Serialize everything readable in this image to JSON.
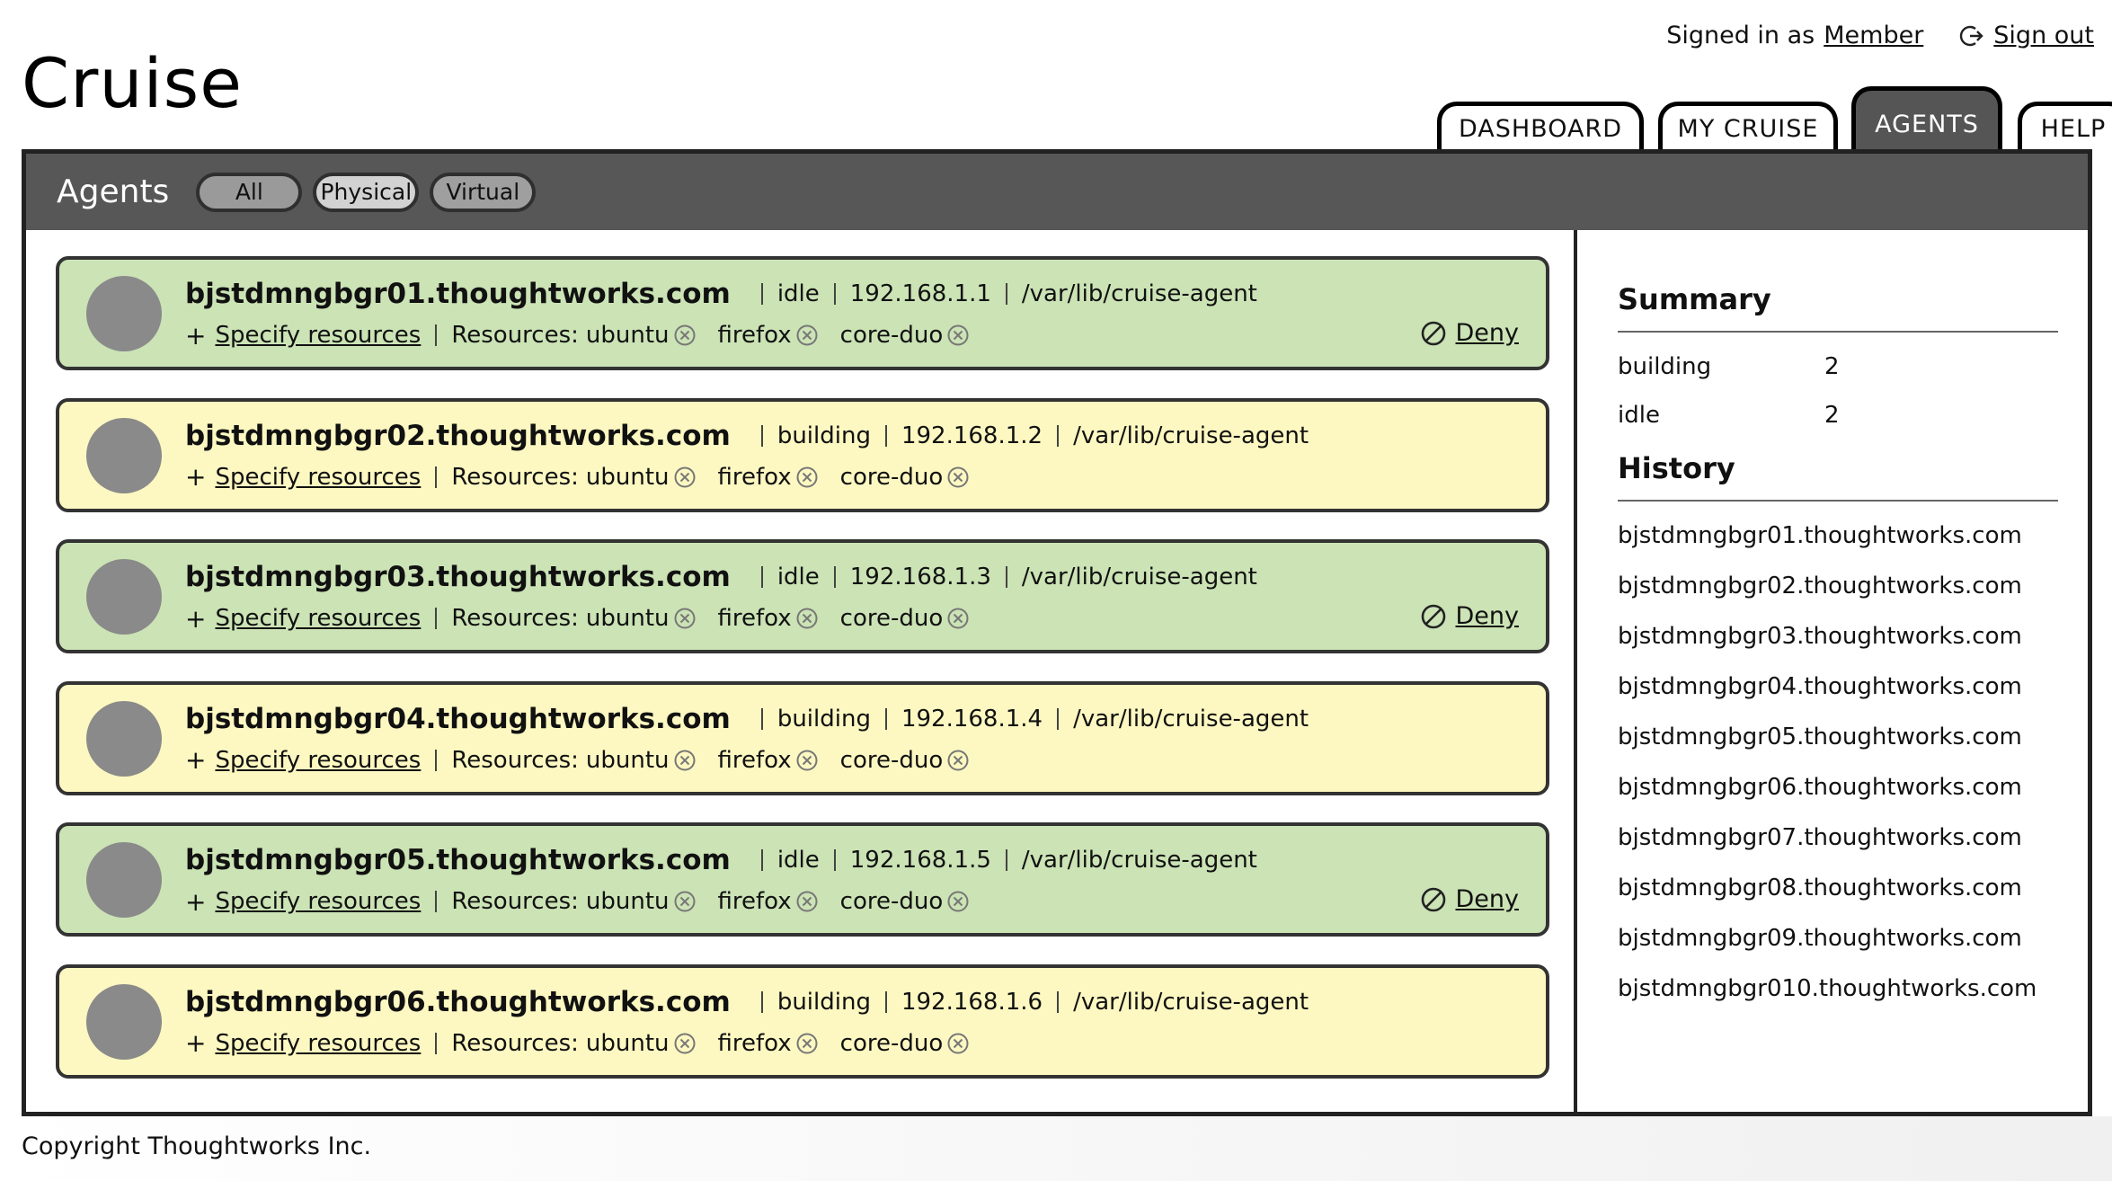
{
  "app": {
    "title": "Cruise"
  },
  "account": {
    "signed_in_prefix": "Signed in as",
    "user": "Member",
    "signout_label": "Sign out"
  },
  "tabs": [
    {
      "label": "DASHBOARD",
      "active": false
    },
    {
      "label": "MY CRUISE",
      "active": false
    },
    {
      "label": "AGENTS",
      "active": true
    },
    {
      "label": "HELP",
      "active": false
    }
  ],
  "subnav": {
    "title": "Agents",
    "filters": [
      "All",
      "Physical",
      "Virtual"
    ]
  },
  "labels": {
    "specify_resources": "Specify resources",
    "resources_prefix": "Resources:",
    "deny": "Deny"
  },
  "agents": [
    {
      "host": "bjstdmngbgr01.thoughtworks.com",
      "status": "idle",
      "ip": "192.168.1.1",
      "path": "/var/lib/cruise-agent",
      "resources": [
        "ubuntu",
        "firefox",
        "core-duo"
      ]
    },
    {
      "host": "bjstdmngbgr02.thoughtworks.com",
      "status": "building",
      "ip": "192.168.1.2",
      "path": "/var/lib/cruise-agent",
      "resources": [
        "ubuntu",
        "firefox",
        "core-duo"
      ]
    },
    {
      "host": "bjstdmngbgr03.thoughtworks.com",
      "status": "idle",
      "ip": "192.168.1.3",
      "path": "/var/lib/cruise-agent",
      "resources": [
        "ubuntu",
        "firefox",
        "core-duo"
      ]
    },
    {
      "host": "bjstdmngbgr04.thoughtworks.com",
      "status": "building",
      "ip": "192.168.1.4",
      "path": "/var/lib/cruise-agent",
      "resources": [
        "ubuntu",
        "firefox",
        "core-duo"
      ]
    },
    {
      "host": "bjstdmngbgr05.thoughtworks.com",
      "status": "idle",
      "ip": "192.168.1.5",
      "path": "/var/lib/cruise-agent",
      "resources": [
        "ubuntu",
        "firefox",
        "core-duo"
      ]
    },
    {
      "host": "bjstdmngbgr06.thoughtworks.com",
      "status": "building",
      "ip": "192.168.1.6",
      "path": "/var/lib/cruise-agent",
      "resources": [
        "ubuntu",
        "firefox",
        "core-duo"
      ]
    }
  ],
  "summary": {
    "title": "Summary",
    "rows": [
      {
        "label": "building",
        "count": "2"
      },
      {
        "label": "idle",
        "count": "2"
      }
    ]
  },
  "history": {
    "title": "History",
    "items": [
      "bjstdmngbgr01.thoughtworks.com",
      "bjstdmngbgr02.thoughtworks.com",
      "bjstdmngbgr03.thoughtworks.com",
      "bjstdmngbgr04.thoughtworks.com",
      "bjstdmngbgr05.thoughtworks.com",
      "bjstdmngbgr06.thoughtworks.com",
      "bjstdmngbgr07.thoughtworks.com",
      "bjstdmngbgr08.thoughtworks.com",
      "bjstdmngbgr09.thoughtworks.com",
      "bjstdmngbgr010.thoughtworks.com"
    ]
  },
  "footer": {
    "text": "Copyright Thoughtworks Inc."
  },
  "colors": {
    "idle_card": "#cbe3b5",
    "building_card": "#fdf8c1",
    "nav_bar": "#575757",
    "avatar": "#8a8a8a"
  },
  "icons": {
    "signout": "signout-icon",
    "remove_resource": "remove-x-icon",
    "deny": "deny-icon"
  }
}
